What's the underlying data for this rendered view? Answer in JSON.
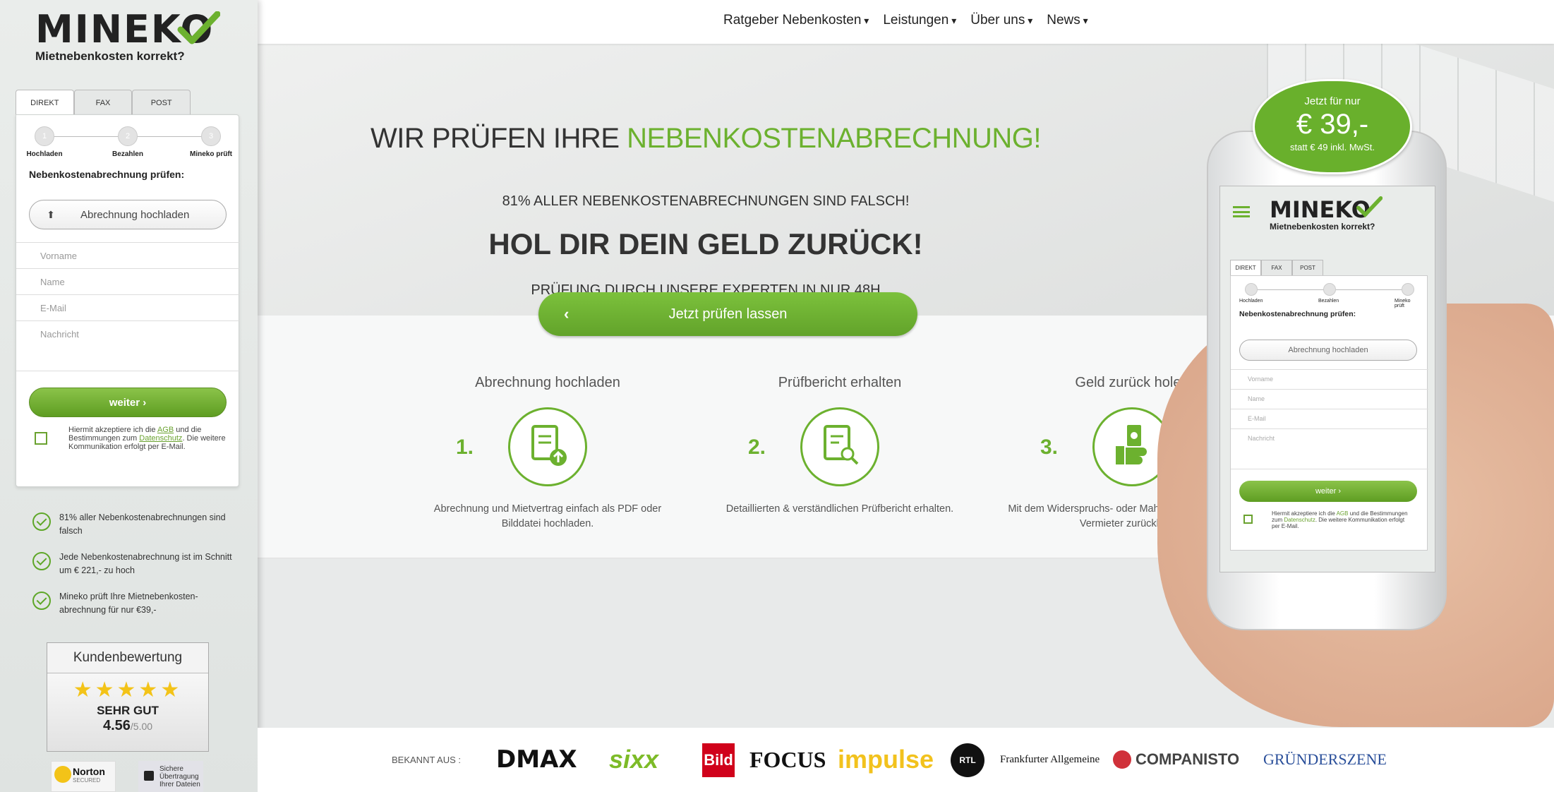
{
  "brand": {
    "name": "MINEKO",
    "tagline": "Mietnebenkosten korrekt?"
  },
  "form_tabs": [
    "DIREKT",
    "FAX",
    "POST"
  ],
  "form_steps": [
    {
      "num": "1",
      "label": "Hochladen"
    },
    {
      "num": "2",
      "label": "Bezahlen"
    },
    {
      "num": "3",
      "label": "Mineko prüft"
    }
  ],
  "form": {
    "title": "Nebenkostenabrechnung prüfen:",
    "upload_label": "Abrechnung hochladen",
    "fields": {
      "vorname": "Vorname",
      "name": "Name",
      "email": "E-Mail",
      "nachricht": "Nachricht"
    },
    "submit_label": "weiter ›",
    "agree_text_1": "Hiermit akzeptiere ich die",
    "agree_link_agb": "AGB",
    "agree_text_2": "und die Bestimmungen zum",
    "agree_link_privacy": "Datenschutz",
    "agree_text_3": ". Die weitere Kommunikation erfolgt per E-Mail."
  },
  "benefits": [
    "81% aller Nebenkostenabrechnungen sind falsch",
    "Jede Nebenkostenabrechnung ist im Schnitt um € 221,- zu hoch",
    "Mineko prüft Ihre Mietnebenkosten-abrechnung für nur €39,-"
  ],
  "rating": {
    "title": "Kundenbewertung",
    "stars": "★★★★★",
    "label": "SEHR GUT",
    "score": "4.56",
    "max": "/5.00"
  },
  "trust": {
    "norton": "Norton",
    "norton_sub": "SECURED",
    "secure": "Sichere Übertragung Ihrer Dateien"
  },
  "nav": [
    "Ratgeber Nebenkosten",
    "Leistungen",
    "Über uns",
    "News"
  ],
  "hero": {
    "h1_plain": "WIR PRÜFEN IHRE ",
    "h1_accent": "NEBENKOSTENABRECHNUNG!",
    "sub1": "81% ALLER NEBENKOSTENABRECHNUNGEN SIND FALSCH!",
    "h2": "HOL DIR DEIN GELD ZURÜCK!",
    "sub2": "PRÜFUNG DURCH UNSERE EXPERTEN IN NUR 48H",
    "cta": "Jetzt prüfen lassen"
  },
  "steps": [
    {
      "num": "1.",
      "title": "Abrechnung hochladen",
      "desc": "Abrechnung und Mietvertrag einfach als PDF oder Bilddatei hochladen.",
      "icon": "document-upload-icon"
    },
    {
      "num": "2.",
      "title": "Prüfbericht erhalten",
      "desc": "Detaillierten & verständlichen Prüfbericht erhalten.",
      "icon": "document-search-icon"
    },
    {
      "num": "3.",
      "title": "Geld zurück holen",
      "desc": "Mit dem Widerspruchs- oder Mahnschreiben Geld vom Vermieter zurückholen.",
      "icon": "money-hand-icon"
    }
  ],
  "price_badge": {
    "line1": "Jetzt für nur",
    "price": "€ 39,-",
    "line3": "statt € 49 inkl. MwSt."
  },
  "press": {
    "label": "BEKANNT AUS :",
    "logos": [
      "DMAX",
      "sixx",
      "Bild",
      "FOCUS",
      "impulse",
      "RTL",
      "Frankfurter Allgemeine",
      "COMPANISTO",
      "GRÜNDERSZENE"
    ]
  },
  "colors": {
    "accent": "#6cb12f",
    "cta": "#6aac2c",
    "text": "#333333"
  }
}
